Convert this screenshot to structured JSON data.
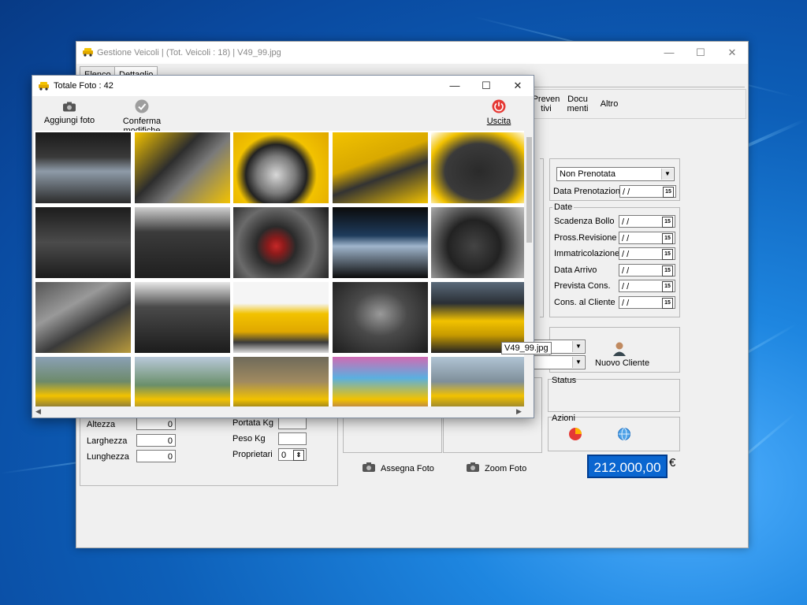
{
  "main_window": {
    "title": "Gestione Veicoli | (Tot. Veicoli : 18) | V49_99.jpg",
    "controls": {
      "minimize": "—",
      "maximize": "☐",
      "close": "✕"
    },
    "tabs": [
      {
        "label": "Elenco"
      },
      {
        "label": "Dettaglio"
      }
    ],
    "toolbar": [
      {
        "label": "Preven\ntivi"
      },
      {
        "label": "Docu\nmenti"
      },
      {
        "label": "Altro"
      }
    ],
    "booking": {
      "status_value": "Non Prenotata",
      "data_prenotazione_label": "Data Prenotazione",
      "data_prenotazione_value": "/ /"
    },
    "dates": {
      "group_label": "Date",
      "rows": [
        {
          "label": "Scadenza Bollo",
          "value": "/ /"
        },
        {
          "label": "Pross.Revisione",
          "value": "/ /"
        },
        {
          "label": "Immatricolazione",
          "value": "/ /"
        },
        {
          "label": "Data Arrivo",
          "value": "/ /"
        },
        {
          "label": "Prevista Cons.",
          "value": "/ /"
        },
        {
          "label": "Cons. al Cliente",
          "value": "/ /"
        }
      ]
    },
    "nuovo_cliente_label": "Nuovo Cliente",
    "status_label": "Status",
    "azioni_label": "Azioni",
    "dimensions": {
      "rows": [
        {
          "label": "Altezza",
          "value": "0"
        },
        {
          "label": "Larghezza",
          "value": "0"
        },
        {
          "label": "Lunghezza",
          "value": "0"
        }
      ]
    },
    "weights": {
      "portata_label": "Portata Kg",
      "peso_label": "Peso Kg",
      "proprietari_label": "Proprietari",
      "proprietari_value": "0"
    },
    "assegna_foto": "Assegna Foto",
    "zoom_foto": "Zoom Foto",
    "price": "212.000,00",
    "currency": "€"
  },
  "gallery": {
    "title": "Totale Foto : 42",
    "controls": {
      "minimize": "—",
      "maximize": "☐",
      "close": "✕"
    },
    "toolbar": {
      "add": "Aggiungi foto",
      "confirm": "Conferma modifiche",
      "exit": "Uscita"
    },
    "tooltip": "V49_99.jpg",
    "photos": [
      {
        "kind": "dashboard"
      },
      {
        "kind": "trim-yellow"
      },
      {
        "kind": "wheel"
      },
      {
        "kind": "badge-yellow"
      },
      {
        "kind": "trunk"
      },
      {
        "kind": "seat-embossed"
      },
      {
        "kind": "rear-seats"
      },
      {
        "kind": "console-red"
      },
      {
        "kind": "screen"
      },
      {
        "kind": "steering"
      },
      {
        "kind": "trim-flag"
      },
      {
        "kind": "interior"
      },
      {
        "kind": "car-yellow"
      },
      {
        "kind": "engine"
      },
      {
        "kind": "car-yellow-dark"
      },
      {
        "kind": "car-road"
      },
      {
        "kind": "car-mountain"
      },
      {
        "kind": "car-motion"
      },
      {
        "kind": "car-colorful"
      },
      {
        "kind": "car-road-2"
      }
    ]
  },
  "colors": {
    "accent": "#0a66d0",
    "car_yellow": "#f2c200",
    "exit_red": "#e53935"
  }
}
